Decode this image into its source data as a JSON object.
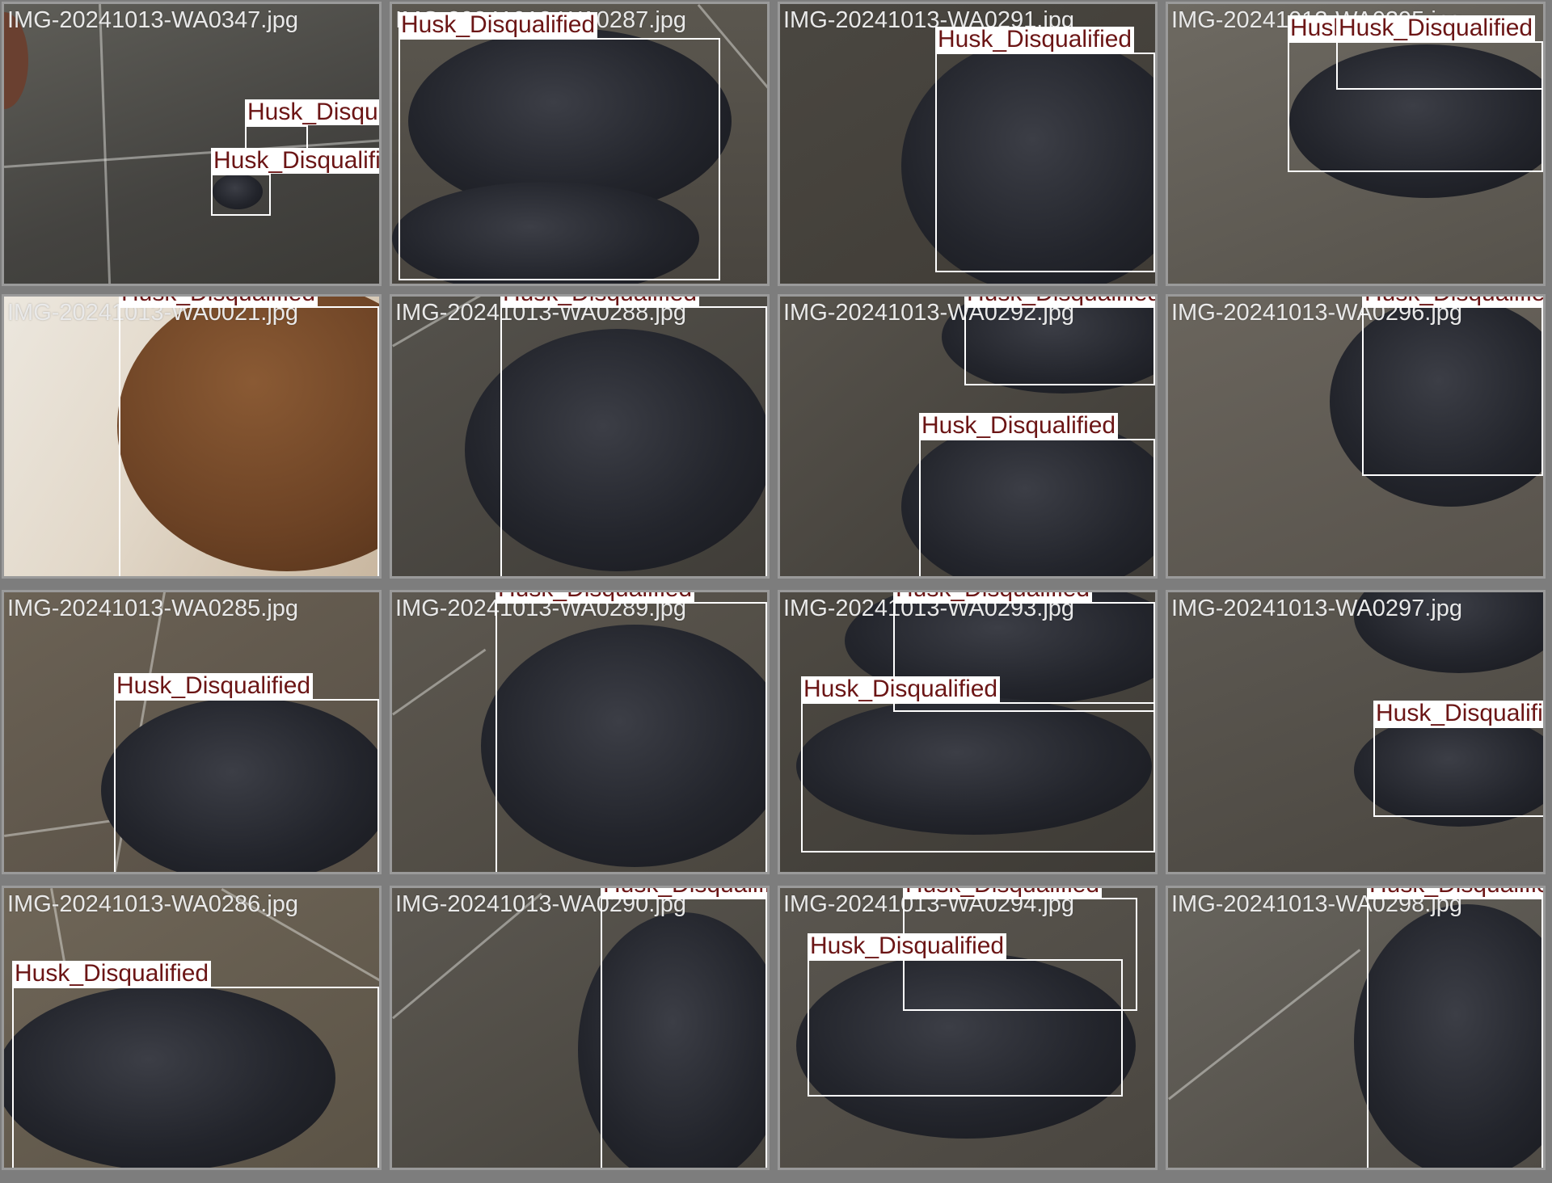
{
  "tiles": [
    {
      "file": "IMG-20241013-WA0347.jpg",
      "boxes": [
        {
          "label": "Husk_Disqualified"
        },
        {
          "label": "Husk_Disqualified"
        }
      ]
    },
    {
      "file": "IMG-20241013-WA0287.jpg",
      "boxes": [
        {
          "label": "Husk_Disqualified"
        }
      ]
    },
    {
      "file": "IMG-20241013-WA0291.jpg",
      "boxes": [
        {
          "label": "Husk_Disqualified"
        }
      ]
    },
    {
      "file": "IMG-20241013-WA0295.jpg",
      "boxes": [
        {
          "label": "Husk_Disqualified"
        },
        {
          "label": "Husk_Disqualified"
        }
      ]
    },
    {
      "file": "IMG-20241013-WA0021.jpg",
      "boxes": [
        {
          "label": "Husk_Disqualified"
        }
      ]
    },
    {
      "file": "IMG-20241013-WA0288.jpg",
      "boxes": [
        {
          "label": "Husk_Disqualified"
        }
      ]
    },
    {
      "file": "IMG-20241013-WA0292.jpg",
      "boxes": [
        {
          "label": "Husk_Disqualified"
        },
        {
          "label": "Husk_Disqualified"
        }
      ]
    },
    {
      "file": "IMG-20241013-WA0296.jpg",
      "boxes": [
        {
          "label": "Husk_Disqualified"
        }
      ]
    },
    {
      "file": "IMG-20241013-WA0285.jpg",
      "boxes": [
        {
          "label": "Husk_Disqualified"
        }
      ]
    },
    {
      "file": "IMG-20241013-WA0289.jpg",
      "boxes": [
        {
          "label": "Husk_Disqualified"
        }
      ]
    },
    {
      "file": "IMG-20241013-WA0293.jpg",
      "boxes": [
        {
          "label": "Husk_Disqualified"
        },
        {
          "label": "Husk_Disqualified"
        }
      ]
    },
    {
      "file": "IMG-20241013-WA0297.jpg",
      "boxes": [
        {
          "label": "Husk_Disqualified"
        }
      ]
    },
    {
      "file": "IMG-20241013-WA0286.jpg",
      "boxes": [
        {
          "label": "Husk_Disqualified"
        }
      ]
    },
    {
      "file": "IMG-20241013-WA0290.jpg",
      "boxes": [
        {
          "label": "Husk_Disqualified"
        }
      ]
    },
    {
      "file": "IMG-20241013-WA0294.jpg",
      "boxes": [
        {
          "label": "Husk_Disqualified"
        },
        {
          "label": "Husk_Disqualified"
        }
      ]
    },
    {
      "file": "IMG-20241013-WA0298.jpg",
      "boxes": [
        {
          "label": "Husk_Disqualified"
        }
      ]
    }
  ]
}
